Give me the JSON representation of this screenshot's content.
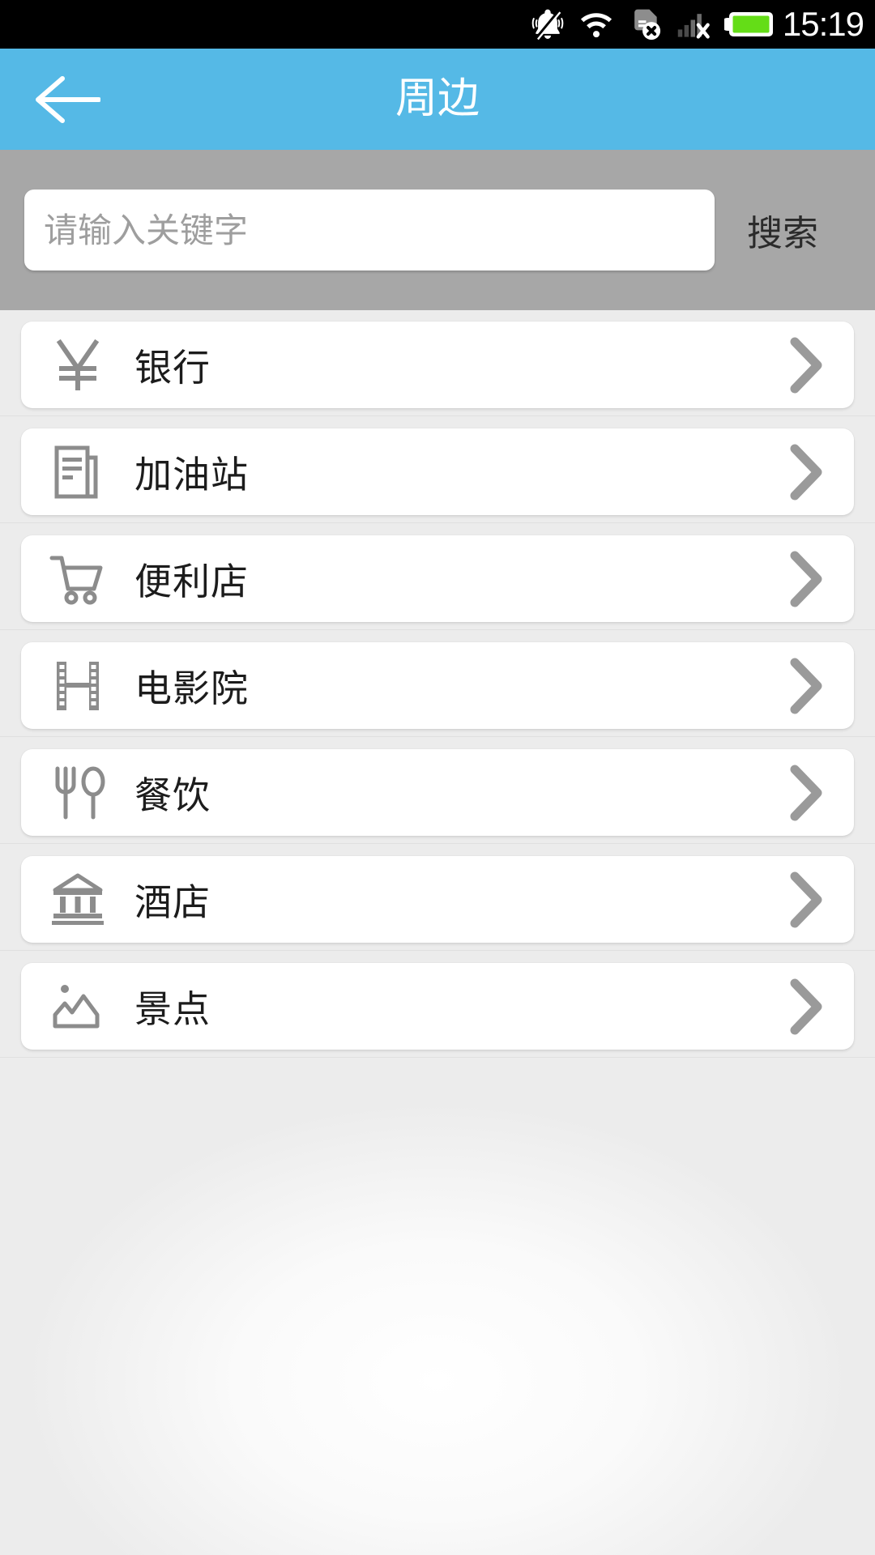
{
  "statusbar": {
    "time": "15:19",
    "icons": [
      {
        "name": "vibrate-silent-icon"
      },
      {
        "name": "wifi-icon"
      },
      {
        "name": "sim-card-error-icon"
      },
      {
        "name": "signal-no-service-icon"
      },
      {
        "name": "battery-full-icon"
      }
    ],
    "battery_color": "#64dd17",
    "background": "#000000"
  },
  "header": {
    "title": "周边",
    "back_icon": "arrow-left-icon",
    "background": "#55b9e6",
    "text_color": "#ffffff"
  },
  "search": {
    "placeholder": "请输入关键字",
    "value": "",
    "button_label": "搜索",
    "background": "#a7a7a7"
  },
  "list": {
    "items": [
      {
        "label": "银行",
        "icon": "yuan-currency-icon",
        "chevron": "chevron-right-icon"
      },
      {
        "label": "加油站",
        "icon": "documents-icon",
        "chevron": "chevron-right-icon"
      },
      {
        "label": "便利店",
        "icon": "shopping-cart-icon",
        "chevron": "chevron-right-icon"
      },
      {
        "label": "电影院",
        "icon": "film-strip-icon",
        "chevron": "chevron-right-icon"
      },
      {
        "label": "餐饮",
        "icon": "fork-spoon-icon",
        "chevron": "chevron-right-icon"
      },
      {
        "label": "酒店",
        "icon": "classical-building-icon",
        "chevron": "chevron-right-icon"
      },
      {
        "label": "景点",
        "icon": "landscape-photo-icon",
        "chevron": "chevron-right-icon"
      }
    ],
    "icon_color": "#8c8c8c",
    "chevron_color": "#9a9a9a",
    "card_background": "#ffffff",
    "page_background": "#ececec"
  }
}
